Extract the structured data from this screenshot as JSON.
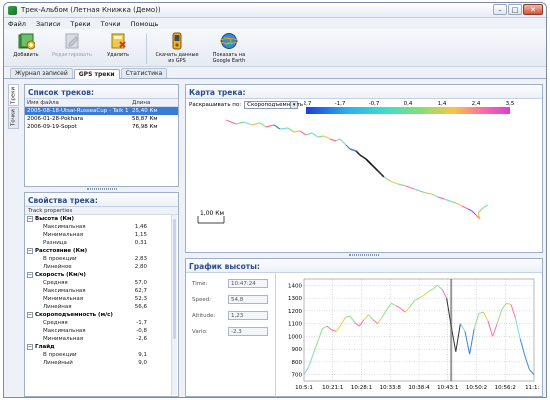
{
  "window": {
    "title": "Трек-Альбом (Летная Книжка (Демо))",
    "min": "–",
    "max": "□",
    "close": "✕"
  },
  "menu": [
    "Файл",
    "Записи",
    "Треки",
    "Точки",
    "Помощь"
  ],
  "toolbar": {
    "add": "Добавить",
    "edit": "Редактировать",
    "delete": "Удалить",
    "gps_download_line1": "Скачать данные",
    "gps_download_line2": "из GPS",
    "google_earth_line1": "Показать на",
    "google_earth_line2": "Google Earth"
  },
  "tabs": [
    "Журнал записей",
    "GPS треки",
    "Статистика"
  ],
  "side_tabs": [
    "Треки",
    "Точки"
  ],
  "track_list": {
    "title": "Список треков:",
    "col_file": "Имя файла",
    "col_length": "Длина",
    "rows": [
      {
        "file": "2005-08-18-Utsai-RusseaCup - Taik 1",
        "length": "25,40 Км"
      },
      {
        "file": "2006-01-28-Pokhara",
        "length": "58,87 Км"
      },
      {
        "file": "2006-09-19-Sopot",
        "length": "76,98 Км"
      }
    ]
  },
  "properties": {
    "title": "Свойства трека:",
    "header": "Track properties",
    "groups": [
      {
        "name": "Высота (Км)",
        "rows": [
          [
            "Максимальная",
            "1,46"
          ],
          [
            "Минимальная",
            "1,15"
          ],
          [
            "Разница",
            "0,31"
          ]
        ]
      },
      {
        "name": "Расстояние (Км)",
        "rows": [
          [
            "В проекции",
            "2,83"
          ],
          [
            "Линейное",
            "2,80"
          ]
        ]
      },
      {
        "name": "Скорость (Км/ч)",
        "rows": [
          [
            "Средняя",
            "57,0"
          ],
          [
            "Максимальная",
            "62,7"
          ],
          [
            "Минимальная",
            "52,3"
          ],
          [
            "Линейная",
            "56,6"
          ]
        ]
      },
      {
        "name": "Скороподъемность (м/с)",
        "rows": [
          [
            "Средняя",
            "-1,7"
          ],
          [
            "Максимальная",
            "-0,8"
          ],
          [
            "Минимальная",
            "-2,6"
          ]
        ]
      },
      {
        "name": "Глайд",
        "rows": [
          [
            "В проекции",
            "9,1"
          ],
          [
            "Линейный",
            "9,0"
          ]
        ]
      }
    ]
  },
  "map": {
    "title": "Карта трека:",
    "color_by_label": "Раскрашивать по:",
    "color_by_value": "Скороподъемность",
    "scale_ticks": [
      "-2,7",
      "-1,7",
      "-0,7",
      "0,4",
      "1,4",
      "2,4",
      "3,5"
    ],
    "scale_bar": "1,00 Км"
  },
  "altitude": {
    "title": "График высоты:",
    "fields": [
      {
        "label": "Time:",
        "value": "10:47:24"
      },
      {
        "label": "Speed:",
        "value": "54,8"
      },
      {
        "label": "Altitude:",
        "value": "1,23"
      },
      {
        "label": "Vario:",
        "value": "-2,3"
      }
    ]
  },
  "chart_data": {
    "type": "line",
    "x_ticks": [
      "10:5:1",
      "10:21:1",
      "10:28:1",
      "10:33:8",
      "10:38:4",
      "10:43:1",
      "10:50:2",
      "10:56:2",
      "11:1:2"
    ],
    "y_ticks": [
      700,
      800,
      900,
      1000,
      1100,
      1200,
      1300,
      1400
    ],
    "ylim": [
      650,
      1450
    ],
    "cursor_at": "10:47:24",
    "series": [
      {
        "x": [
          0,
          2,
          4,
          6,
          8,
          10,
          12,
          14,
          16,
          18,
          20,
          22,
          24,
          26,
          28,
          30,
          32,
          34,
          36,
          38,
          40,
          42,
          44,
          46,
          48,
          50,
          52,
          54,
          56,
          58,
          60,
          62,
          64,
          66,
          68,
          70,
          72,
          74,
          76,
          78,
          80,
          82,
          84,
          86,
          88,
          90,
          92,
          94,
          96,
          98,
          100
        ],
        "values": [
          700,
          760,
          860,
          960,
          1060,
          1080,
          1050,
          1040,
          1090,
          1150,
          1160,
          1110,
          1080,
          1130,
          1170,
          1130,
          1100,
          1150,
          1210,
          1260,
          1240,
          1220,
          1190,
          1230,
          1280,
          1300,
          1320,
          1350,
          1370,
          1400,
          1370,
          1300,
          1080,
          880,
          1100,
          1040,
          860,
          1060,
          1180,
          1190,
          1120,
          1000,
          1100,
          1210,
          1260,
          1250,
          1140,
          980,
          850,
          740,
          700
        ],
        "colors": [
          "#7fd6e8",
          "#7fd6e8",
          "#8de08a",
          "#8de08a",
          "#8de08a",
          "#ff6fa3",
          "#ff6fa3",
          "#f5c842",
          "#f5c842",
          "#8de08a",
          "#8de08a",
          "#ff6fa3",
          "#ff6fa3",
          "#f5c842",
          "#8de08a",
          "#ff6fa3",
          "#f5c842",
          "#8de08a",
          "#8de08a",
          "#8de08a",
          "#ff6fa3",
          "#ff6fa3",
          "#f5c842",
          "#8de08a",
          "#8de08a",
          "#f5c842",
          "#f5c842",
          "#8de08a",
          "#8de08a",
          "#8de08a",
          "#ff6fa3",
          "#333333",
          "#333333",
          "#333333",
          "#7fd6e8",
          "#3a86e0",
          "#3a86e0",
          "#8de08a",
          "#8de08a",
          "#f5c842",
          "#ff6fa3",
          "#ff6fa3",
          "#8de08a",
          "#8de08a",
          "#f5c842",
          "#ff6fa3",
          "#7fd6e8",
          "#3a86e0",
          "#3a86e0",
          "#3a86e0"
        ]
      }
    ]
  }
}
